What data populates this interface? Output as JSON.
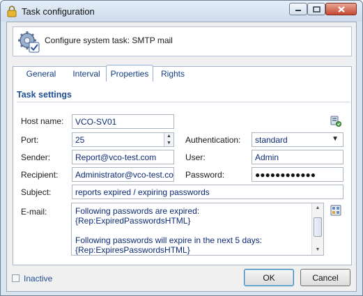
{
  "window": {
    "title": "Task configuration"
  },
  "header": {
    "text": "Configure system task: SMTP mail"
  },
  "tabs": [
    {
      "label": "General"
    },
    {
      "label": "Interval"
    },
    {
      "label": "Properties"
    },
    {
      "label": "Rights"
    }
  ],
  "active_tab": "Properties",
  "section": {
    "title": "Task settings"
  },
  "form": {
    "host": {
      "label": "Host name:",
      "value": "VCO-SV01"
    },
    "port": {
      "label": "Port:",
      "value": "25"
    },
    "auth": {
      "label": "Authentication:",
      "value": "standard"
    },
    "sender": {
      "label": "Sender:",
      "value": "Report@vco-test.com"
    },
    "user": {
      "label": "User:",
      "value": "Admin"
    },
    "recipient": {
      "label": "Recipient:",
      "value": "Administrator@vco-test.com"
    },
    "password": {
      "label": "Password:",
      "value": "●●●●●●●●●●●●"
    },
    "subject": {
      "label": "Subject:",
      "value": "reports expired / expiring passwords"
    },
    "email": {
      "label": "E-mail:",
      "lines": [
        "Following passwords are expired:",
        "{Rep:ExpiredPasswordsHTML}",
        "",
        "Following passwords will expire in the next 5 days:",
        "{Rep:ExpiresPasswordsHTML}"
      ]
    }
  },
  "footer": {
    "inactive_label": "Inactive",
    "inactive_checked": false,
    "ok_label": "OK",
    "cancel_label": "Cancel"
  },
  "icons": {
    "title": "lock-icon",
    "header": "gear-check-icon",
    "host_action": "server-test-icon",
    "email_action": "template-editor-icon"
  },
  "colors": {
    "accent": "#1f4e92",
    "value_text": "#0c2b74",
    "tab_text": "#123d82"
  }
}
